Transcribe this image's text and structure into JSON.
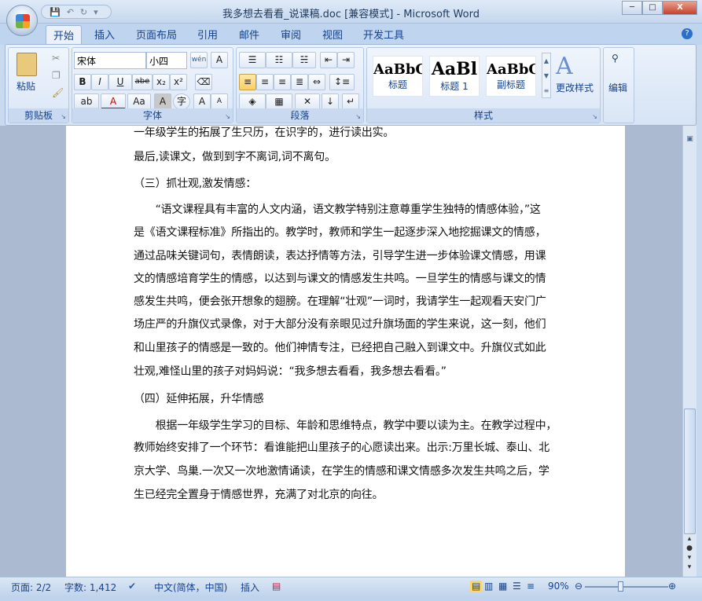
{
  "window": {
    "title": "我多想去看看_说课稿.doc [兼容模式] - Microsoft Word",
    "min": "─",
    "max": "□",
    "close": "X"
  },
  "qat": {
    "save": "💾",
    "undo": "↶",
    "redo": "↻",
    "more": "▾"
  },
  "tabs": [
    "开始",
    "插入",
    "页面布局",
    "引用",
    "邮件",
    "审阅",
    "视图",
    "开发工具"
  ],
  "ribbon": {
    "clipboard": {
      "label": "剪贴板",
      "paste": "粘贴"
    },
    "font": {
      "label": "字体",
      "font_name": "宋体",
      "font_size": "小四",
      "bold": "B",
      "italic": "I",
      "underline": "U",
      "strike": "abe",
      "sub": "x₂",
      "sup": "x²",
      "grow": "A",
      "shrink": "A",
      "case": "Aa",
      "char_shade": "A",
      "enclose": "字",
      "phonetic": "wén",
      "border_char": "A"
    },
    "paragraph": {
      "label": "段落"
    },
    "styles": {
      "label": "样式",
      "items": [
        {
          "preview": "AaBbC",
          "name": "标题"
        },
        {
          "preview": "AaBl",
          "name": "标题 1"
        },
        {
          "preview": "AaBbC",
          "name": "副标题"
        }
      ],
      "change": "更改样式"
    },
    "editing": {
      "label": "编辑"
    }
  },
  "document": {
    "lines": [
      "一年级学生的拓展了生只历，在识字的，进行读出实。",
      "最后,读课文，做到到字不离词,词不离句。",
      "（三）抓壮观,激发情感：",
      "　　“语文课程具有丰富的人文内涵，语文教学特别注意尊重学生独特的情感体验，”这",
      "是《语文课程标准》所指出的。教学时，教师和学生一起逐步深入地挖掘课文的情感，",
      "通过品味关键词句，表情朗读，表达抒情等方法，引导学生进一步体验课文情感，用课",
      "文的情感培育学生的情感，以达到与课文的情感发生共鸣。一旦学生的情感与课文的情",
      "感发生共鸣，便会张开想象的翅膀。在理解“壮观”一词时，我请学生一起观看天安门广",
      "场庄严的升旗仪式录像，对于大部分没有亲眼见过升旗场面的学生来说，这一刻，他们",
      "和山里孩子的情感是一致的。他们神情专注，已经把自己融入到课文中。升旗仪式如此",
      "壮观,难怪山里的孩子对妈妈说：“我多想去看看，我多想去看看。”",
      "（四）延伸拓展，升华情感",
      "　　根据一年级学生学习的目标、年龄和思维特点，教学中要以读为主。在教学过程中，",
      "教师始终安排了一个环节：看谁能把山里孩子的心愿读出来。出示:万里长城、泰山、北",
      "京大学、鸟巢.一次又一次地激情诵读，在学生的情感和课文情感多次发生共鸣之后，学",
      "生已经完全置身于情感世界，充满了对北京的向往。"
    ]
  },
  "status": {
    "page": "页面: 2/2",
    "words": "字数: 1,412",
    "language": "中文(简体，中国)",
    "mode": "插入",
    "zoom": "90%",
    "zoom_percent": 90
  }
}
